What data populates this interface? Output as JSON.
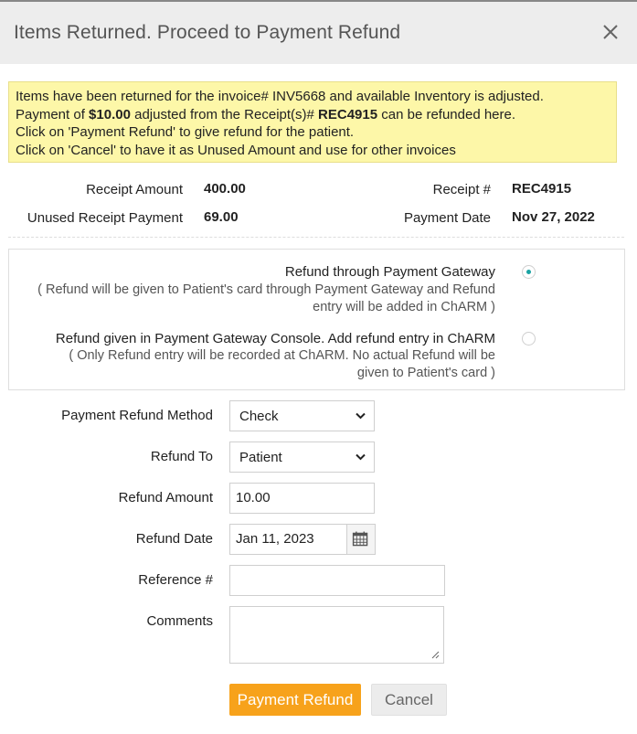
{
  "dialog": {
    "title": "Items Returned. Proceed to Payment Refund",
    "close_icon": "close-icon"
  },
  "notice": {
    "line1": "Items have been returned for the invoice# INV5668 and available Inventory is adjusted.",
    "line2_prefix": "Payment of ",
    "line2_amount": "$10.00",
    "line2_middle": " adjusted from the Receipt(s)# ",
    "line2_receipt": "REC4915",
    "line2_suffix": " can be refunded here.",
    "line3": "Click on 'Payment Refund' to give refund for the patient.",
    "line4": "Click on 'Cancel' to have it as Unused Amount and use for other invoices"
  },
  "summary": {
    "receipt_amount_label": "Receipt Amount",
    "receipt_amount_value": "400.00",
    "receipt_no_label": "Receipt #",
    "receipt_no_value": "REC4915",
    "unused_label": "Unused Receipt Payment",
    "unused_value": "69.00",
    "payment_date_label": "Payment Date",
    "payment_date_value": "Nov 27, 2022"
  },
  "refund_options": [
    {
      "title": "Refund through Payment Gateway",
      "desc_line1": "( Refund will be given to Patient's card through Payment Gateway and Refund",
      "desc_line2": "entry will be added in ChARM )",
      "selected": true
    },
    {
      "title": "Refund given in Payment Gateway Console. Add refund entry in ChARM",
      "desc_line1": "( Only Refund entry will be recorded at ChARM. No actual Refund will be",
      "desc_line2": "given to Patient's card )",
      "selected": false
    }
  ],
  "form": {
    "method_label": "Payment Refund Method",
    "method_value": "Check",
    "refund_to_label": "Refund To",
    "refund_to_value": "Patient",
    "amount_label": "Refund Amount",
    "amount_value": "10.00",
    "date_label": "Refund Date",
    "date_value": "Jan 11, 2023",
    "reference_label": "Reference #",
    "reference_value": "",
    "comments_label": "Comments",
    "comments_value": ""
  },
  "buttons": {
    "refund": "Payment Refund",
    "cancel": "Cancel"
  },
  "colors": {
    "accent": "#f7a21b",
    "notice_bg": "#fdf7a8",
    "radio_selected": "#1aa3a3"
  }
}
